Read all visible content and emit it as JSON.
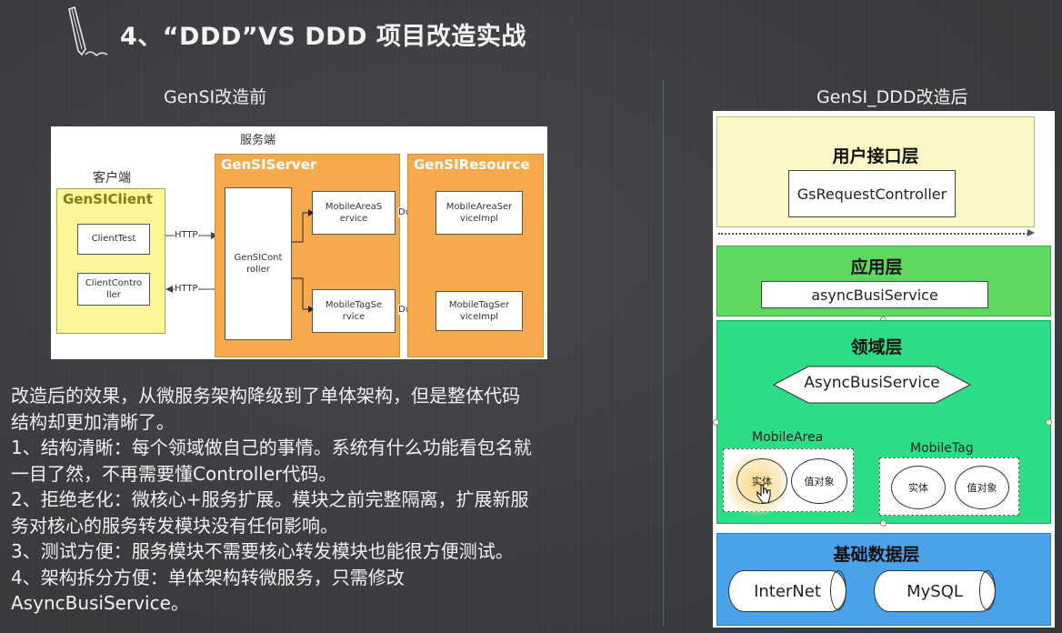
{
  "slide": {
    "title": "4、“DDD”VS DDD 项目改造实战",
    "left_heading": "GenSI改造前",
    "right_heading": "GenSI_DDD改造后"
  },
  "before_diagram": {
    "server_side_label": "服务端",
    "client_side_label": "客户端",
    "client_group": "GenSIClient",
    "server_group": "GenSIServer",
    "resource_group": "GenSIResource",
    "client_test": "ClientTest",
    "client_controller": "ClientController",
    "controller": "GenSIController",
    "mobile_area_service": "MobileAreaService",
    "mobile_tag_service": "MobileTagService",
    "mobile_area_impl": "MobileAreaServiceImpl",
    "mobile_tag_impl": "MobileTagServiceImpl",
    "http_label_1": "HTTP",
    "http_label_2": "HTTP",
    "dubbo_label_1": "Dubbo",
    "dubbo_label_2": "Dubbo",
    "split": {
      "client_controller": [
        "ClientContro",
        "ller"
      ],
      "controller": [
        "GenSICont",
        "roller"
      ],
      "mobile_area_service": [
        "MobileAreaS",
        "ervice"
      ],
      "mobile_tag_service": [
        "MobileTagSe",
        "rvice"
      ],
      "mobile_area_impl": [
        "MobileAreaSer",
        "viceImpl"
      ],
      "mobile_tag_impl": [
        "MobileTagSer",
        "viceImpl"
      ]
    }
  },
  "body_text": [
    "改造后的效果，从微服务架构降级到了单体架构，但是整体代码",
    "结构却更加清晰了。",
    "1、结构清晰：每个领域做自己的事情。系统有什么功能看包名就",
    "一目了然，不再需要懂Controller代码。",
    "2、拒绝老化：微核心+服务扩展。模块之前完整隔离，扩展新服",
    "务对核心的服务转发模块没有任何影响。",
    "3、测试方便：服务模块不需要核心转发模块也能很方便测试。",
    "4、架构拆分方便：单体架构转微服务，只需修改",
    "AsyncBusiService。"
  ],
  "after_diagram": {
    "ui_layer": {
      "title": "用户接口层",
      "component": "GsRequestController",
      "color": "#fbf7c6"
    },
    "app_layer": {
      "title": "应用层",
      "component": "asyncBusiService",
      "color": "#5fd85f"
    },
    "domain_layer": {
      "title": "领域层",
      "color": "#2ddc86",
      "service": "AsyncBusiService",
      "mobile_area": {
        "label": "MobileArea",
        "entity": "实体",
        "value_object": "值对象"
      },
      "mobile_tag": {
        "label": "MobileTag",
        "entity": "实体",
        "value_object": "值对象"
      }
    },
    "infra_layer": {
      "title": "基础数据层",
      "color": "#4aa3ea",
      "stores": [
        "InterNet",
        "MySQL"
      ]
    }
  }
}
